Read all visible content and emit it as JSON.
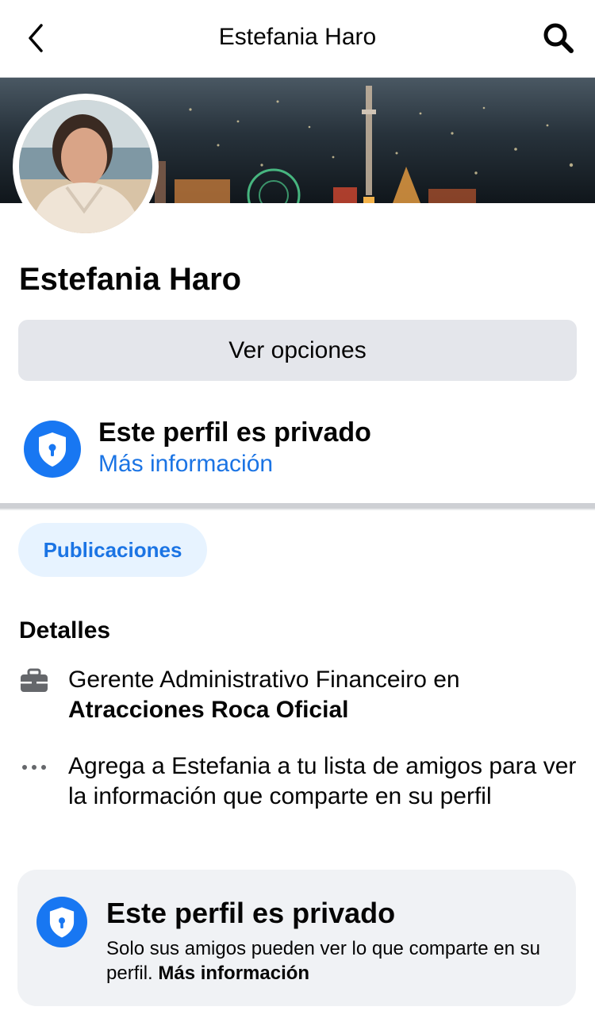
{
  "header": {
    "title": "Estefania Haro"
  },
  "profile": {
    "name": "Estefania Haro",
    "options_label": "Ver opciones"
  },
  "privacy_notice": {
    "title": "Este perfil es privado",
    "link": "Más información"
  },
  "tabs": {
    "posts_label": "Publicaciones"
  },
  "details": {
    "heading": "Detalles",
    "work_prefix": "Gerente Administrativo Financeiro en",
    "work_company": "Atracciones Roca Oficial",
    "friend_hint": "Agrega a Estefania a tu lista de amigos para ver la información que comparte en su perfil"
  },
  "private_card": {
    "title": "Este perfil es privado",
    "body": "Solo sus amigos pueden ver lo que comparte en su perfil.",
    "link": "Más información"
  },
  "icons": {
    "back": "chevron-left-icon",
    "search": "search-icon",
    "privacy": "shield-lock-icon",
    "work": "briefcase-icon",
    "more": "more-horizontal-icon"
  },
  "colors": {
    "accent": "#1877f2",
    "link": "#1b74e4",
    "chip_bg": "#e7f3ff",
    "button_bg": "#e4e6eb",
    "card_bg": "#f0f2f5"
  }
}
